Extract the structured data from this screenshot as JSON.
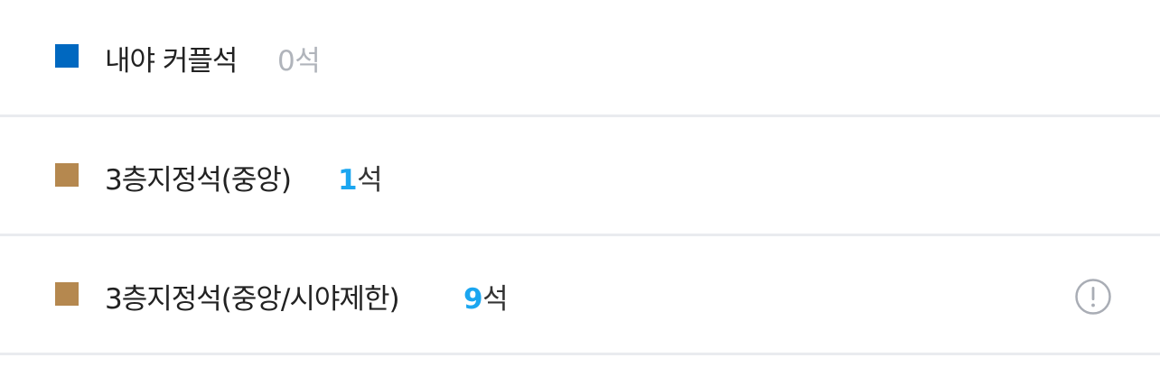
{
  "colors": {
    "couple_swatch": "#0068c0",
    "third_floor_swatch": "#b5884f",
    "count_highlight": "#1ba6f0",
    "count_zero": "#b0b4bb",
    "divider": "#e9ebef"
  },
  "seat_grades": [
    {
      "label": "내야 커플석",
      "count_value": "0",
      "count_unit": "석",
      "swatch_color": "#0068c0",
      "available": false
    },
    {
      "label": "3층지정석(중앙)",
      "count_value": "1",
      "count_unit": "석",
      "swatch_color": "#b5884f",
      "available": true
    },
    {
      "label": "3층지정석(중앙/시야제한)",
      "count_value": "9",
      "count_unit": "석",
      "swatch_color": "#b5884f",
      "available": true,
      "info_icon": "info-circle-icon"
    }
  ]
}
